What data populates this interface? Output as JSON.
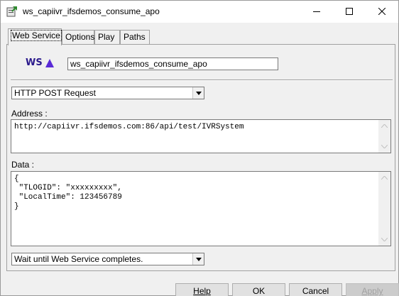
{
  "window": {
    "title": "ws_capiivr_ifsdemos_consume_apo"
  },
  "tabs": [
    {
      "label": "Web Service",
      "active": true
    },
    {
      "label": "Options",
      "active": false
    },
    {
      "label": "Play",
      "active": false
    },
    {
      "label": "Paths",
      "active": false
    }
  ],
  "webservice": {
    "logo_text": "WS",
    "name_value": "ws_capiivr_ifsdemos_consume_apo",
    "method_selected": "HTTP POST Request",
    "address_label": "Address :",
    "address_value": "http://capiivr.ifsdemos.com:86/api/test/IVRSystem",
    "data_label": "Data :",
    "data_value": "{\n \"TLOGID\": \"xxxxxxxxx\",\n \"LocalTime\": 123456789\n}",
    "wait_selected": "Wait until Web Service completes."
  },
  "buttons": {
    "help": "Help",
    "ok": "OK",
    "cancel": "Cancel",
    "apply": "Apply"
  },
  "colors": {
    "logo": "#2b1a8c",
    "disabled_text": "#a0a0a0"
  }
}
